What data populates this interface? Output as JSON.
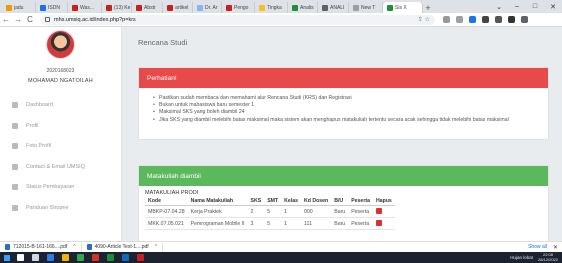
{
  "browser": {
    "tabs": [
      {
        "title": "jadu",
        "color": "#f29900"
      },
      {
        "title": "ISDN",
        "color": "#1a73e8"
      },
      {
        "title": "Was...",
        "color": "#c5221f"
      },
      {
        "title": "(13) Ke",
        "color": "#c5221f"
      },
      {
        "title": "Abstr",
        "color": "#c5221f"
      },
      {
        "title": "artikel",
        "color": "#c5221f"
      },
      {
        "title": "Dr. Ar",
        "color": "#8ab4f8"
      },
      {
        "title": "Pengo",
        "color": "#c5221f"
      },
      {
        "title": "Tingka",
        "color": "#f6c026"
      },
      {
        "title": "Analis",
        "color": "#1e8e3e"
      },
      {
        "title": "ANALI",
        "color": "#5f6368"
      },
      {
        "title": "New T",
        "color": "#9aa0a6"
      }
    ],
    "active_tab": {
      "title": "Sis X",
      "color": "#1e8e3e"
    },
    "new_tab": "+",
    "window_controls": [
      "⌄",
      "–",
      "□",
      "✕"
    ],
    "url": "mhs.umsiq.ac.id/index.php?p=krs",
    "back": "←",
    "forward": "→",
    "reload": "C",
    "omnibox_icons": "⇪ ☆",
    "extension_colors": [
      "#999",
      "#9aa0a6",
      "#1a73e8",
      "#444",
      "#555",
      "#333",
      "#5f6368"
    ]
  },
  "profile": {
    "nim": "2020168023",
    "name": "MOHAMAD NGATOILAH"
  },
  "sidebar": {
    "items": [
      {
        "label": "Dashboard",
        "icon": "dashboard-icon"
      },
      {
        "label": "Profil",
        "icon": "user-icon"
      },
      {
        "label": "Foto Profil",
        "icon": "image-icon"
      },
      {
        "label": "Contact & Email UMSIQ",
        "icon": "phone-icon"
      },
      {
        "label": "Status Pembayaran",
        "icon": "calendar-icon"
      },
      {
        "label": "Panduan Shopee",
        "icon": "book-icon"
      }
    ]
  },
  "main": {
    "title": "Rencana Studi",
    "notice": {
      "title": "Perhatian!",
      "items": [
        "Pastikan sudah membaca dan memahami alur Rencana Studi (KRS) dan Registrasi",
        "Bukan untuk mahasiswa baru semester 1",
        "Maksimal SKS yang boleh diambil 24",
        "Jika SKS yang diambil melebihi batas maksimal maka sistem akan menghapus matakuliah tertentu secara acak sehingga tidak melebihi batas maksimal"
      ]
    },
    "taken": {
      "title": "Matakuliah diambil",
      "subhead": "MATAKULIAH PRODI",
      "columns": [
        "Kode",
        "Nama Matakuliah",
        "SKS",
        "SMT",
        "Kelas",
        "Kd Dosen",
        "B/U",
        "Peserta",
        "Hapus"
      ],
      "rows": [
        [
          "MBKP-07.04.28",
          "Kerja Praktek",
          "2",
          "5",
          "1",
          "000",
          "Baru",
          "Peserta",
          ""
        ],
        [
          "MKK.07.05.021",
          "Pemrograman Mobile II",
          "3",
          "5",
          "1",
          "111",
          "Baru",
          "Peserta",
          ""
        ]
      ]
    }
  },
  "downloads": {
    "items": [
      "712015-B-161-166....pdf",
      "4090-Article Text-1....pdf"
    ],
    "show_all": "Show all",
    "close": "✕"
  },
  "taskbar": {
    "weather": "Hujan lebat",
    "time": "22:08",
    "date": "28/12/2022",
    "app_colors": [
      "#ffffff",
      "#cfd8e3",
      "#2b7de9",
      "#f3b300",
      "#2fa84f",
      "#d93025",
      "#1e8e3e",
      "#0f6cbd",
      "#c5221f"
    ]
  }
}
